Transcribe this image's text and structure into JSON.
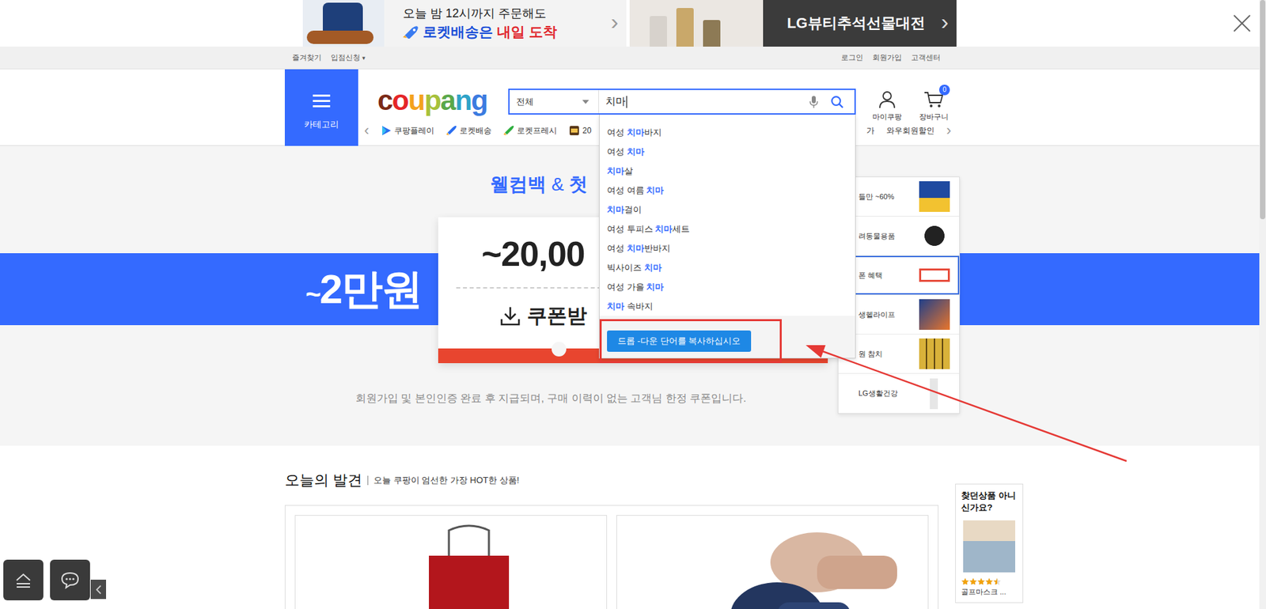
{
  "rocket_banner": {
    "line1": "오늘 밤 12시까지 주문해도",
    "line2": "로켓배송은",
    "line2_accent": "내일 도착",
    "arrow": "›"
  },
  "beauty_banner": {
    "text": "LG뷰티추석선물대전",
    "arrow": "›"
  },
  "utility_bar": {
    "left": [
      "즐겨찾기",
      "입점신청"
    ],
    "caret": "▾",
    "right": [
      "로그인",
      "회원가입",
      "고객센터"
    ]
  },
  "header": {
    "category": "카테고리",
    "logo": "coupang",
    "my_coupang": "마이쿠팡",
    "cart": {
      "label": "장바구니",
      "count": "0"
    }
  },
  "search": {
    "scope": "전체",
    "query": "치마",
    "focused": true
  },
  "nav": {
    "prev": "‹",
    "next": "›",
    "items": [
      "쿠팡플레이",
      "로켓배송",
      "로켓프레시",
      "20"
    ],
    "right_items": [
      "가",
      "와우회원할인"
    ]
  },
  "suggestions": [
    {
      "prefix": "여성 ",
      "match": "치마",
      "suffix": "바지"
    },
    {
      "prefix": "여성 ",
      "match": "치마",
      "suffix": ""
    },
    {
      "prefix": "",
      "match": "치마",
      "suffix": "살"
    },
    {
      "prefix": "여성 여름 ",
      "match": "치마",
      "suffix": ""
    },
    {
      "prefix": "",
      "match": "치마",
      "suffix": "걸이"
    },
    {
      "prefix": "여성 투피스 ",
      "match": "치마",
      "suffix": "세트"
    },
    {
      "prefix": "여성 ",
      "match": "치마",
      "suffix": "반바지"
    },
    {
      "prefix": "빅사이즈 ",
      "match": "치마",
      "suffix": ""
    },
    {
      "prefix": "여성 가을 ",
      "match": "치마",
      "suffix": ""
    },
    {
      "prefix": "",
      "match": "치마",
      "suffix": " 속바지"
    }
  ],
  "copy_button": "드롭 -다운 단어를 복사하십시오",
  "promo": {
    "title": "웰컴백",
    "amp": "&",
    "title_cut": "첫",
    "band_tilde": "~",
    "band": "2만원",
    "amount": "~20,00",
    "coupon": "쿠폰받",
    "note": "회원가입 및 본인인증 완료 후 지급되며, 구매 이력이 없는 고객님 한정 쿠폰입니다."
  },
  "side_panel": [
    {
      "label": "들만 ~60%",
      "selected": false
    },
    {
      "label": "려동물용품",
      "selected": false
    },
    {
      "label": "폰 혜택",
      "selected": true
    },
    {
      "label": "생헬라이프",
      "selected": false
    },
    {
      "label": "원 참치",
      "selected": false
    },
    {
      "label": "LG생활건강",
      "selected": false
    }
  ],
  "discovery": {
    "title": "오늘의 발견",
    "subtitle": "오늘 쿠팡이 엄선한 가장 HOT한 상품!"
  },
  "recommend": {
    "title": "찾던상품 아니신가요?",
    "stars": 4.5,
    "product": "골프마스크 ..."
  },
  "scrollbar": {
    "level": 0.36
  }
}
